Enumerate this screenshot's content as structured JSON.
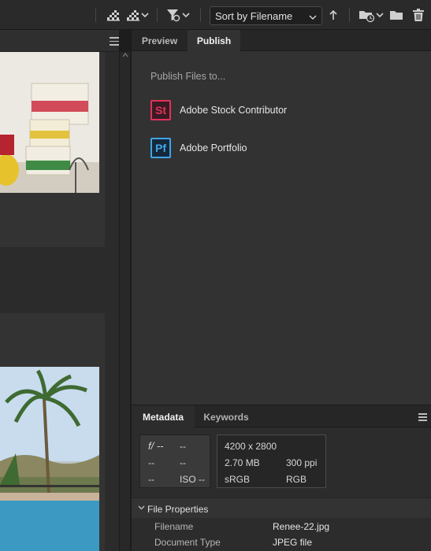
{
  "toolbar": {
    "sort_label": "Sort by Filename",
    "icons": [
      "quality-icon",
      "quality-dropdown-icon",
      "filter-icon",
      "sort-order-icon",
      "open-recent-icon",
      "new-folder-icon",
      "trash-icon"
    ]
  },
  "publish_panel": {
    "tabs": [
      {
        "label": "Preview",
        "active": false
      },
      {
        "label": "Publish",
        "active": true
      }
    ],
    "title": "Publish Files to...",
    "services": [
      {
        "icon_text": "St",
        "label": "Adobe Stock Contributor",
        "color": "#e2325b",
        "bg": "#3a1a22"
      },
      {
        "icon_text": "Pf",
        "label": "Adobe Portfolio",
        "color": "#3fa6e8",
        "bg": "#15283a"
      }
    ]
  },
  "metadata_panel": {
    "tabs": [
      {
        "label": "Metadata",
        "active": true
      },
      {
        "label": "Keywords",
        "active": false
      }
    ],
    "camera_data": {
      "aperture": "f/ --",
      "shutter": "--",
      "r2c1": "--",
      "r2c2": "--",
      "r3c1": "--",
      "iso": "ISO --"
    },
    "image_data": {
      "dimensions": "4200 x 2800",
      "size": "2.70 MB",
      "resolution": "300 ppi",
      "color_space": "sRGB",
      "mode": "RGB"
    },
    "file_properties": {
      "title": "File Properties",
      "rows": [
        {
          "key": "Filename",
          "value": "Renee-22.jpg"
        },
        {
          "key": "Document Type",
          "value": "JPEG file"
        }
      ]
    }
  },
  "thumbnails": [
    {
      "name": "tea-boxes-photo"
    },
    {
      "name": "pool-palm-photo"
    }
  ]
}
